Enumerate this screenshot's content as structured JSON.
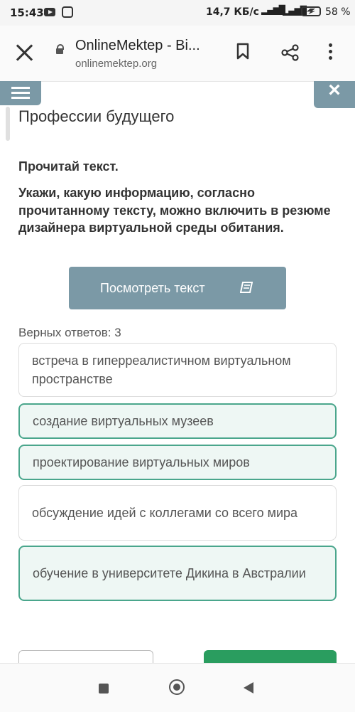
{
  "status": {
    "time": "15:43",
    "speed": "14,7 КБ/с",
    "network": "4G",
    "battery": "58 %"
  },
  "browser": {
    "title": "OnlineMektep - Bi...",
    "url": "onlinemektep.org"
  },
  "lesson": {
    "title": "Профессии будущего"
  },
  "task": {
    "instruction": "Прочитай текст.",
    "question": "Укажи, какую информацию, согласно прочитанному тексту, можно включить в резюме дизайнера виртуальной среды обитания."
  },
  "view_text_button": "Посмотреть текст",
  "correct_answers": "Верных ответов: 3",
  "answers": [
    {
      "text": "встреча в гиперреалистичном виртуальном пространстве",
      "selected": false
    },
    {
      "text": "создание виртуальных музеев",
      "selected": true
    },
    {
      "text": "проектирование виртуальных миров",
      "selected": true
    },
    {
      "text": "обсуждение идей с коллегами со всего мира",
      "selected": false
    },
    {
      "text": "обучение в университете Дикина в Австралии",
      "selected": true
    }
  ],
  "colors": {
    "accent": "#7b99a6",
    "selected_border": "#4aa68c",
    "selected_bg": "#eef7f4",
    "primary_button": "#2a9d5f"
  }
}
